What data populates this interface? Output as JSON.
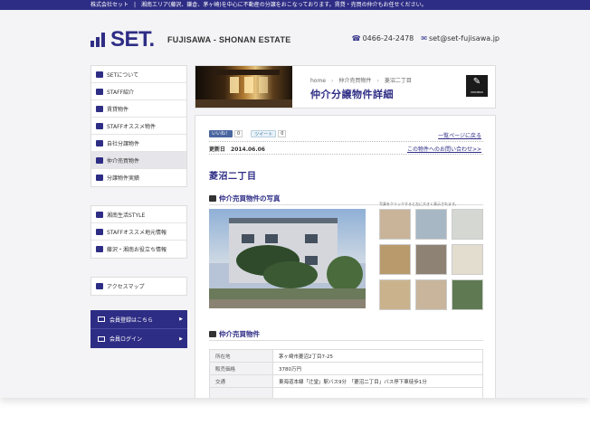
{
  "topbar": {
    "company": "株式会社セット",
    "message": "湘南エリア(藤沢、鎌倉、茅ヶ崎)を中心に不動産の分譲をおこなっております。賃貸・売買の仲介もお任せください。"
  },
  "header": {
    "logo_text": "SET.",
    "tagline": "FUJISAWA - SHONAN  ESTATE",
    "phone": "0466-24-2478",
    "email": "set@set-fujisawa.jp"
  },
  "sidebar": {
    "group1": [
      {
        "label": "SETについて"
      },
      {
        "label": "STAFF紹介"
      },
      {
        "label": "賃貸物件"
      },
      {
        "label": "STAFFオススメ物件"
      },
      {
        "label": "自社分譲物件"
      },
      {
        "label": "仲介売買物件"
      },
      {
        "label": "分譲物件実績"
      }
    ],
    "group2": [
      {
        "label": "湘南生活STYLE"
      },
      {
        "label": "STAFFオススメ地元情報"
      },
      {
        "label": "藤沢・湘南お役立ち情報"
      }
    ],
    "group3": [
      {
        "label": "アクセスマップ"
      }
    ],
    "member": {
      "register": "会員登録はこちら",
      "login": "会員ログイン"
    }
  },
  "hero": {
    "breadcrumb": [
      "home",
      "仲介売買物件",
      "菱沼二丁目"
    ],
    "title": "仲介分譲物件詳細",
    "badge_label": "MODERN"
  },
  "content": {
    "like_label": "いいね！",
    "like_count": "0",
    "tweet_label": "ツイート",
    "tweet_count": "0",
    "back_link": "一覧ページに戻る",
    "updated_label": "更新日",
    "updated_date": "2014.06.06",
    "inquiry_link": "この物件へのお問い合わせ>>",
    "property_title": "菱沼二丁目",
    "photos_heading": "仲介売買物件の写真",
    "thumb_caption": "写真をクリックすると左に大きく表示されます。",
    "info_heading": "仲介売買物件",
    "specs": [
      {
        "label": "所在地",
        "value": "茅ヶ崎市菱沼2丁目7-25"
      },
      {
        "label": "販売価格",
        "value": "3780万円"
      },
      {
        "label": "交通",
        "value": "東海道本線「辻堂」駅バス9分　「菱沼二丁目」バス停下車徒歩1分"
      },
      {
        "label": "",
        "value": ""
      }
    ]
  },
  "colors": {
    "brand": "#2e2d85",
    "thumbs": [
      "#c9b49a",
      "#a7b7c4",
      "#d5d7d3",
      "#b99a6c",
      "#8e8275",
      "#e3ddd0",
      "#cab38c",
      "#c8b59b",
      "#5f7a52"
    ]
  }
}
